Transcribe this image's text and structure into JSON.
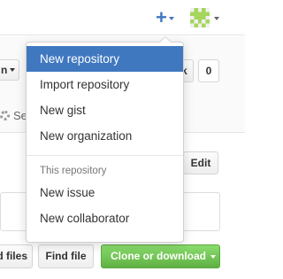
{
  "header": {
    "plus_icon": "plus-icon",
    "avatar_icon": "identicon-avatar",
    "avatar_color": "#a5d65c"
  },
  "background": {
    "left_dropdown_label": "n",
    "star_button_label": "k",
    "fork_count": "0",
    "settings_label": "Se",
    "edit_label": "Edit",
    "upload_label": "d files",
    "find_file_label": "Find file",
    "clone_label": "Clone or download",
    "clone_color": "#6cc644"
  },
  "dropdown": {
    "items": [
      {
        "label": "New repository",
        "active": true
      },
      {
        "label": "Import repository"
      },
      {
        "label": "New gist"
      },
      {
        "label": "New organization"
      }
    ],
    "section_header": "This repository",
    "section_items": [
      {
        "label": "New issue"
      },
      {
        "label": "New collaborator"
      }
    ],
    "accent_color": "#4078c0"
  }
}
